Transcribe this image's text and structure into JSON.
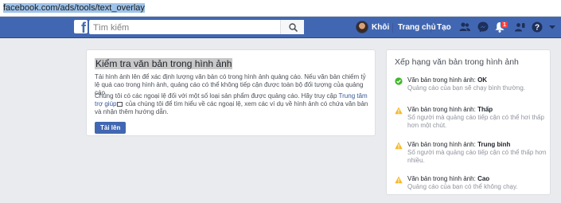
{
  "browser": {
    "url": "facebook.com/ads/tools/text_overlay"
  },
  "header": {
    "logo_letter": "f",
    "search_placeholder": "Tìm kiếm",
    "profile_name": "Khôi",
    "home_label": "Trang chủ",
    "create_label": "Tạo",
    "notification_count": "1",
    "brand_color": "#4267b2"
  },
  "main": {
    "title": "Kiểm tra văn bản trong hình ảnh",
    "paragraph1": "Tải hình ảnh lên để xác định lượng văn bản có trong hình ảnh quảng cáo. Nếu văn bản chiếm tỷ lệ quá cao trong hình ảnh, quảng cáo có thể không tiếp cận được toàn bộ đối tượng của quảng cáo.",
    "paragraph2_before": "Chúng tôi có các ngoại lệ đối với một số loại sản phẩm được quảng cáo. Hãy truy cập ",
    "paragraph2_link": "Trung tâm trợ giúp",
    "paragraph2_after": " của chúng tôi để tìm hiểu về các ngoại lệ, xem các ví dụ về hình ảnh có chứa văn bản và nhận thêm hướng dẫn.",
    "upload_label": "Tải lên"
  },
  "ratings_panel": {
    "title": "Xếp hạng văn bản trong hình ảnh",
    "items": [
      {
        "prefix": "Văn bản trong hình ảnh: ",
        "level": "OK",
        "description": "Quảng cáo của bạn sẽ chạy bình thường.",
        "icon": "check-circle-icon",
        "color": "#42b72a"
      },
      {
        "prefix": "Văn bản trong hình ảnh: ",
        "level": "Thấp",
        "description": "Số người mà quảng cáo tiếp cận có thể hơi thấp hơn một chút.",
        "icon": "warning-icon",
        "color": "#f7b928"
      },
      {
        "prefix": "Văn bản trong hình ảnh: ",
        "level": "Trung bình",
        "description": "Số người mà quảng cáo tiếp cận có thể thấp hơn nhiều.",
        "icon": "warning-icon",
        "color": "#f7b928"
      },
      {
        "prefix": "Văn bản trong hình ảnh: ",
        "level": "Cao",
        "description": "Quảng cáo của bạn có thể không chạy.",
        "icon": "warning-icon",
        "color": "#f7b928"
      }
    ]
  }
}
